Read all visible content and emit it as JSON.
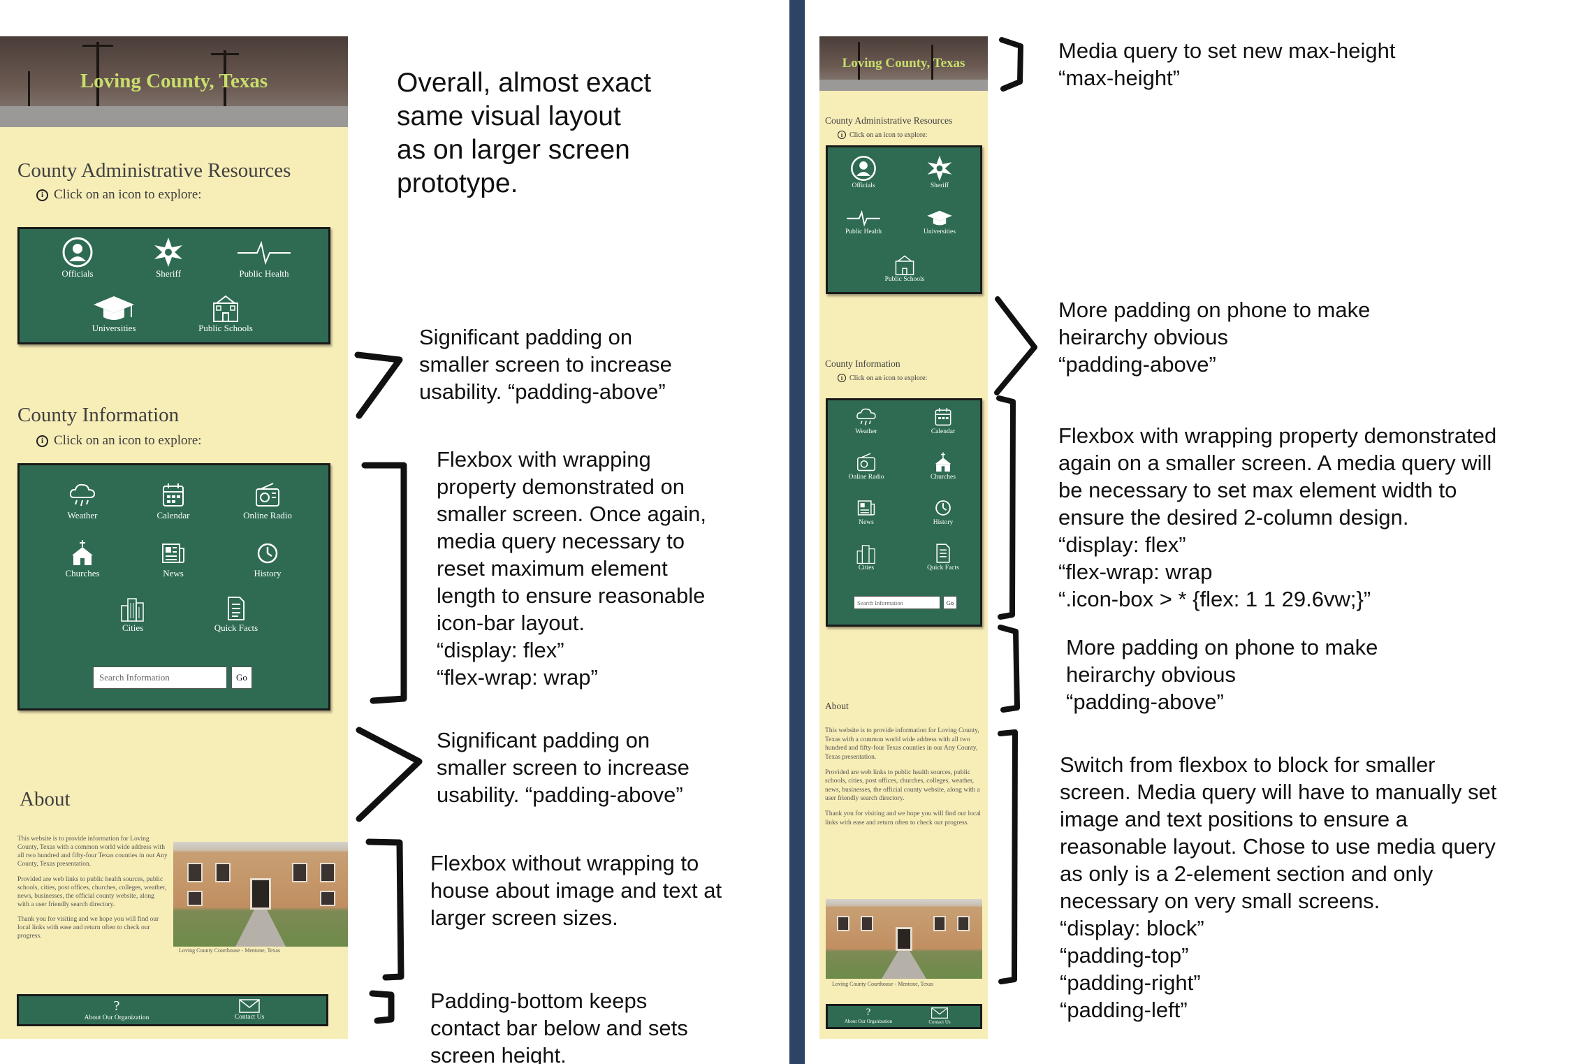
{
  "left_mockup": {
    "hero_title": "Loving County, Texas",
    "admin": {
      "title": "County Administrative Resources",
      "hint": "Click on an icon to explore:",
      "items": [
        {
          "label": "Officials",
          "icon": "user-circle-icon"
        },
        {
          "label": "Sheriff",
          "icon": "sheriff-star-icon"
        },
        {
          "label": "Public Health",
          "icon": "heartbeat-icon"
        },
        {
          "label": "Universities",
          "icon": "graduation-cap-icon"
        },
        {
          "label": "Public Schools",
          "icon": "school-building-icon"
        }
      ]
    },
    "info": {
      "title": "County Information",
      "hint": "Click on an icon to explore:",
      "items": [
        {
          "label": "Weather",
          "icon": "weather-cloud-icon"
        },
        {
          "label": "Calendar",
          "icon": "calendar-icon"
        },
        {
          "label": "Online Radio",
          "icon": "radio-icon"
        },
        {
          "label": "Churches",
          "icon": "church-icon"
        },
        {
          "label": "News",
          "icon": "newspaper-icon"
        },
        {
          "label": "History",
          "icon": "clock-icon"
        },
        {
          "label": "Cities",
          "icon": "city-buildings-icon"
        },
        {
          "label": "Quick Facts",
          "icon": "document-icon"
        }
      ],
      "search_placeholder": "Search Information",
      "go_label": "Go"
    },
    "about": {
      "title": "About",
      "paragraphs": [
        "This website is to provide information for Loving County, Texas with a common world wide address with all two hundred and fifty-four Texas counties in our Any County, Texas presentation.",
        "Provided are web links to public health sources, public schools, cities, post offices, churches, colleges, weather, news, businesses, the official county website, along with a user friendly search directory.",
        "Thank you for visiting and we hope you will find our local links with ease and return often to check our progress."
      ],
      "caption": "Loving County Courthouse - Mentone, Texas"
    },
    "footer": {
      "about_org": "About Our Organization",
      "about_icon": "?",
      "contact": "Contact Us"
    }
  },
  "right_mockup": {
    "hero_title": "Loving County, Texas",
    "admin": {
      "title": "County Administrative Resources",
      "hint": "Click on an icon to explore:",
      "items": [
        {
          "label": "Officials"
        },
        {
          "label": "Sheriff"
        },
        {
          "label": "Public Health"
        },
        {
          "label": "Universities"
        },
        {
          "label": "Public Schools"
        }
      ]
    },
    "info": {
      "title": "County Information",
      "hint": "Click on an icon to explore:",
      "items": [
        {
          "label": "Weather"
        },
        {
          "label": "Calendar"
        },
        {
          "label": "Online Radio"
        },
        {
          "label": "Churches"
        },
        {
          "label": "News"
        },
        {
          "label": "History"
        },
        {
          "label": "Cities"
        },
        {
          "label": "Quick Facts"
        }
      ],
      "search_placeholder": "Search Information",
      "go_label": "Go"
    },
    "about": {
      "title": "About",
      "paragraphs": [
        "This website is to provide information for Loving County, Texas with a common world wide address with all two hundred and fifty-four Texas counties in our Any County, Texas presentation.",
        "Provided are web links to public health sources, public schools, cities, post offices, churches, colleges, weather, news, businesses, the official county website, along with a user friendly search directory.",
        "Thank you for visiting and we hope you will find our local links with ease and return often to check our progress."
      ],
      "caption": "Loving County Courthouse - Mentone, Texas"
    },
    "footer": {
      "about_org": "About Our Organization",
      "about_icon": "?",
      "contact": "Contact Us"
    }
  },
  "annotations": {
    "overall": "Overall, almost exact\nsame visual layout\nas on larger screen\nprototype.",
    "left_padding_1": "Significant padding on\nsmaller screen to increase\nusability. “padding-above”",
    "left_flexbox": "Flexbox with wrapping\nproperty demonstrated on\nsmaller screen. Once again,\nmedia query necessary to\nreset maximum element\nlength to ensure reasonable\nicon-bar layout.\n“display: flex”\n“flex-wrap: wrap”",
    "left_padding_2": "Significant padding on\nsmaller screen to increase\nusability. “padding-above”",
    "left_about": "Flexbox without wrapping to\nhouse about image and text at\nlarger screen sizes.",
    "left_bottom": "Padding-bottom keeps\ncontact bar below and sets\nscreen height.",
    "right_maxheight": "Media query to set new max-height\n“max-height”",
    "right_padding_1": "More padding on phone to make\nheirarchy obvious\n“padding-above”",
    "right_flexbox": "Flexbox with wrapping property demonstrated\nagain on a smaller screen. A media query will\nbe necessary to set max element width to\nensure the desired 2-column design.\n“display: flex”\n“flex-wrap: wrap\n“.icon-box > * {flex: 1 1 29.6vw;}”",
    "right_padding_2": "More padding on phone to make\nheirarchy obvious\n“padding-above”",
    "right_block": "Switch from flexbox to block for smaller\nscreen. Media query will have to manually set\nimage and text positions to ensure a\nreasonable layout. Chose to use media query\nas only is a 2-element section and only\nnecessary on very small screens.\n“display: block”\n“padding-top”\n“padding-right”\n“padding-left”"
  },
  "colors": {
    "page_bg": "#f7edb7",
    "box_green": "#2e6b52",
    "hero_title": "#c8de6d",
    "divider": "#2d4466"
  }
}
